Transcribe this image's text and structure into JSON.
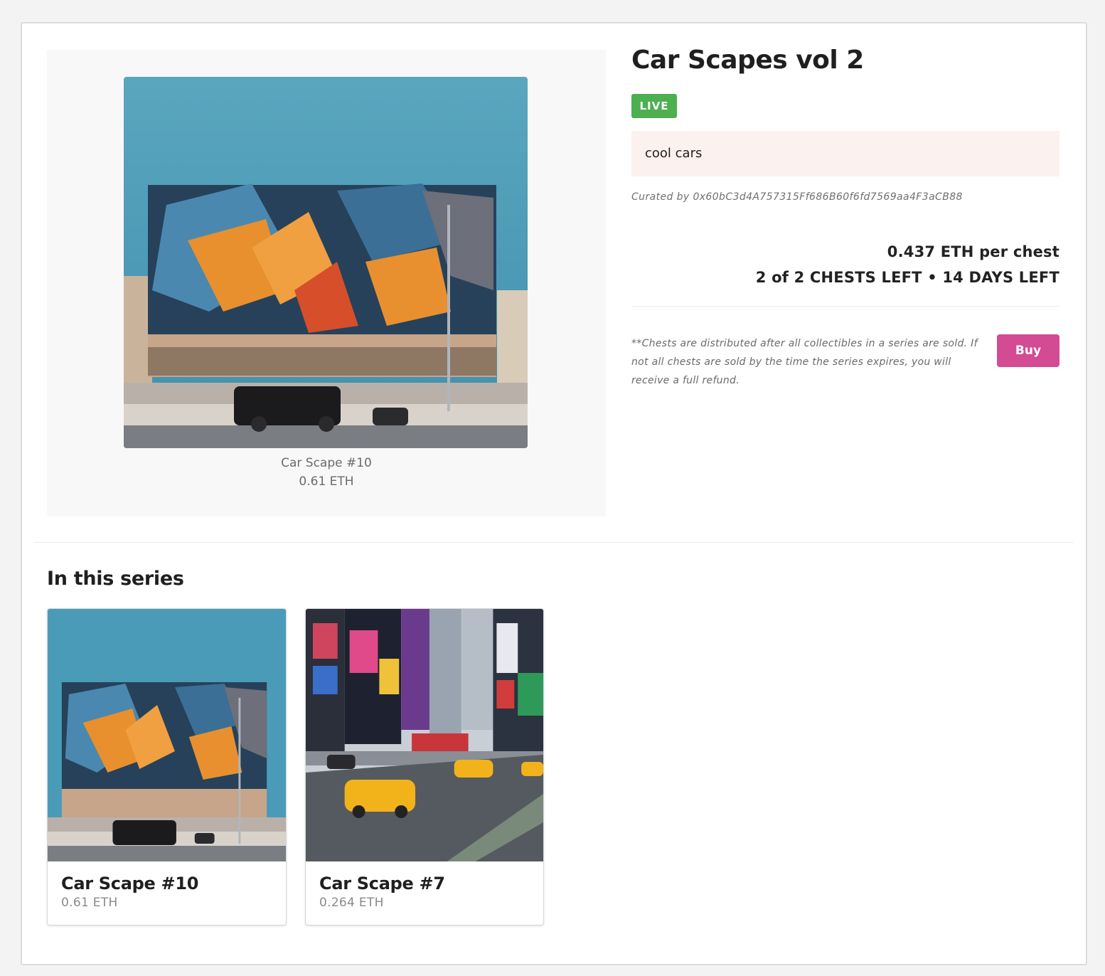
{
  "series": {
    "title": "Car Scapes vol 2",
    "status": "LIVE",
    "description": "cool cars",
    "curated_by": "Curated by 0x60bC3d4A757315Ff686B60f6fd7569aa4F3aCB88",
    "price_per_chest": "0.437 ETH per chest",
    "availability": "2 of 2 CHESTS LEFT • 14 DAYS LEFT",
    "disclaimer": "**Chests are distributed after all collectibles in a series are sold. If not all chests are sold by the time the series expires, you will receive a full refund.",
    "buy_label": "Buy"
  },
  "featured": {
    "name": "Car Scape #10",
    "price": "0.61 ETH"
  },
  "collection": {
    "heading": "In this series",
    "items": [
      {
        "name": "Car Scape #10",
        "price": "0.61 ETH"
      },
      {
        "name": "Car Scape #7",
        "price": "0.264 ETH"
      }
    ]
  },
  "colors": {
    "live_badge": "#4caf50",
    "buy_button": "#d24b93",
    "description_bg": "#fbf1ef"
  }
}
